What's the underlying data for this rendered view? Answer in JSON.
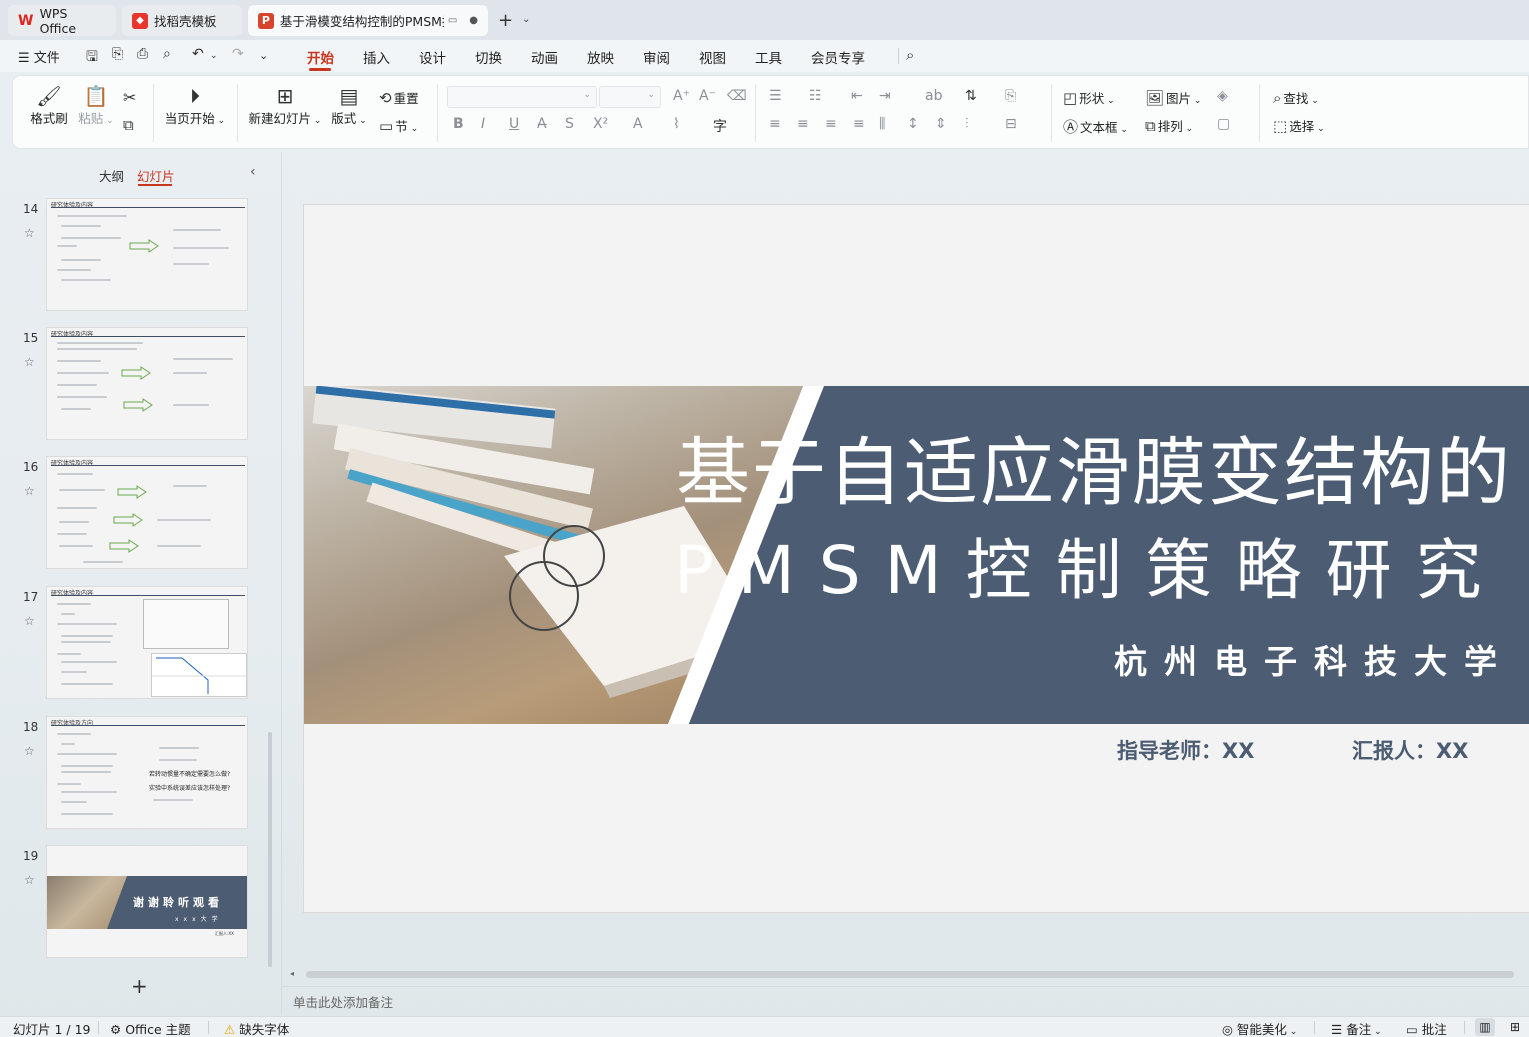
{
  "tabs": [
    {
      "label": "WPS Office"
    },
    {
      "label": "找稻壳模板"
    },
    {
      "label": "基于滑模变结构控制的PMSM控制策略研究"
    }
  ],
  "menu": {
    "file": "文件",
    "items": [
      "开始",
      "插入",
      "设计",
      "切换",
      "动画",
      "放映",
      "审阅",
      "视图",
      "工具",
      "会员专享"
    ],
    "active": "开始"
  },
  "ribbon": {
    "format_painter": "格式刷",
    "paste": "粘贴",
    "play_current": "当页开始",
    "new_slide": "新建幻灯片",
    "layout": "版式",
    "reset": "重置",
    "section": "节",
    "shape": "形状",
    "picture": "图片",
    "find": "查找",
    "textbox": "文本框",
    "arrange": "排列",
    "select": "选择"
  },
  "left_panel": {
    "tab_outline": "大纲",
    "tab_slides": "幻灯片",
    "slides": [
      {
        "num": "14",
        "header": "研究体验及内容"
      },
      {
        "num": "15",
        "header": "研究体验及内容"
      },
      {
        "num": "16",
        "header": "研究体验及内容"
      },
      {
        "num": "17",
        "header": "研究体验及内容"
      },
      {
        "num": "18",
        "header": "研究体验及方向",
        "q1": "若转动惯量不确定需要怎么做?",
        "q2": "实验中系统误差应该怎样处理?"
      },
      {
        "num": "19",
        "t1": "谢谢聆听观看",
        "t2": "xxx大学",
        "t3": "汇报人:XX"
      }
    ]
  },
  "slide": {
    "title_line1": "基于自适应滑膜变结构的",
    "title_line2": "PMSM控制策略研究",
    "university": "杭州电子科技大学",
    "advisor": "指导老师：XX",
    "reporter": "汇报人：XX"
  },
  "notes_placeholder": "单击此处添加备注",
  "status": {
    "slide_count": "幻灯片 1 / 19",
    "theme": "Office 主题",
    "missing_font": "缺失字体",
    "smart_beautify": "智能美化",
    "notes": "备注",
    "comments": "批注"
  },
  "colors": {
    "accent": "#c8361f",
    "slide_band": "#4c5d73"
  }
}
